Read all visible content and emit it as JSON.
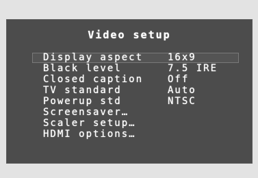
{
  "menu": {
    "title": "Video setup",
    "items": [
      {
        "label": "Display aspect",
        "value": "16x9",
        "selected": true
      },
      {
        "label": "Black level",
        "value": "7.5 IRE"
      },
      {
        "label": "Closed caption",
        "value": "Off"
      },
      {
        "label": "TV standard",
        "value": "Auto"
      },
      {
        "label": "Powerup std",
        "value": "NTSC"
      },
      {
        "label": "Screensaver…",
        "value": ""
      },
      {
        "label": "Scaler setup…",
        "value": ""
      },
      {
        "label": "HDMI options…",
        "value": ""
      }
    ]
  },
  "colors": {
    "background": "#e3e3e3",
    "osd_panel": "#4c4c4c",
    "text": "#ffffff"
  }
}
